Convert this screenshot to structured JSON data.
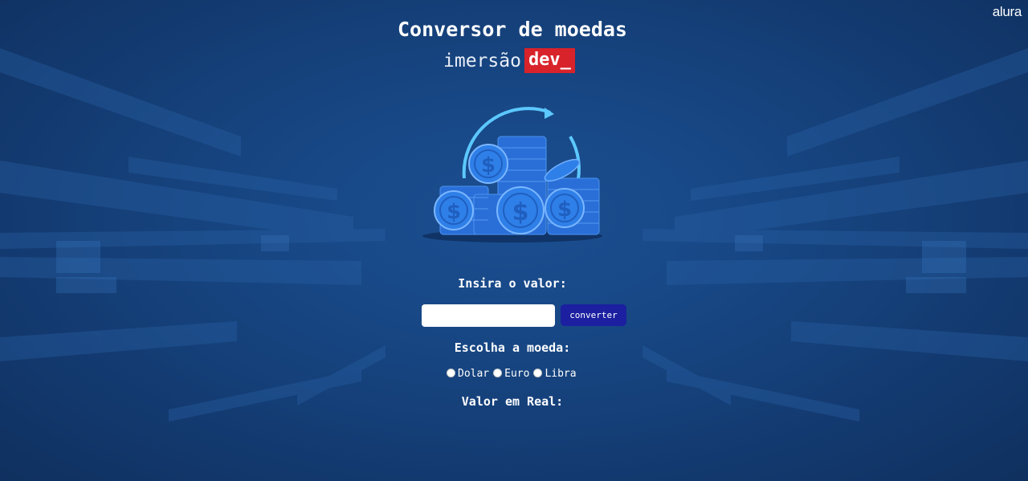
{
  "brand": {
    "alura_logo": "alura",
    "title": "Conversor de moedas",
    "subtitle_text": "imersão",
    "subtitle_tag": "dev_",
    "tag_color": "#d8232a"
  },
  "illustration": {
    "icon": "coins-stack-icon",
    "coin_symbol": "$"
  },
  "form": {
    "value_label": "Insira o valor:",
    "value_input": "",
    "value_placeholder": "",
    "convert_label": "converter",
    "currency_label": "Escolha a moeda:",
    "currencies": [
      {
        "label": "Dolar",
        "selected": false
      },
      {
        "label": "Euro",
        "selected": false
      },
      {
        "label": "Libra",
        "selected": false
      }
    ],
    "result_label": "Valor em Real:"
  },
  "colors": {
    "background": "#174683",
    "button": "#1b1fa0",
    "coin": "#2f7fe8",
    "arrow": "#5cc8ff"
  }
}
